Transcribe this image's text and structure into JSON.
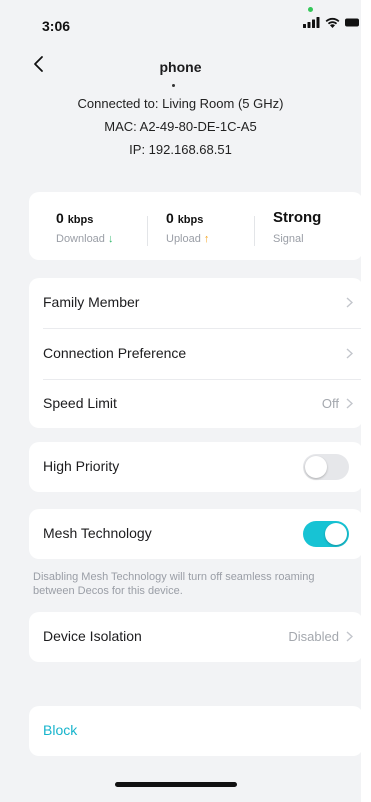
{
  "status_bar": {
    "time": "3:06"
  },
  "header": {
    "title": "phone"
  },
  "device_info": {
    "connected_to": "Connected to: Living Room (5 GHz)",
    "mac": "MAC: A2-49-80-DE-1C-A5",
    "ip": "IP: 192.168.68.51"
  },
  "stats": {
    "download": {
      "value": "0",
      "unit": "kbps",
      "label": "Download",
      "arrow": "↓",
      "arrow_color": "#33b86c"
    },
    "upload": {
      "value": "0",
      "unit": "kbps",
      "label": "Upload",
      "arrow": "↑",
      "arrow_color": "#f5a623"
    },
    "signal": {
      "value": "Strong",
      "label": "Signal"
    }
  },
  "settings": {
    "family_member": "Family Member",
    "connection_preference": "Connection Preference",
    "speed_limit": {
      "label": "Speed Limit",
      "value": "Off"
    }
  },
  "high_priority": {
    "label": "High Priority",
    "enabled": false
  },
  "mesh": {
    "label": "Mesh Technology",
    "enabled": true,
    "note": "Disabling Mesh Technology will turn off seamless roaming between Decos for this device."
  },
  "device_isolation": {
    "label": "Device Isolation",
    "value": "Disabled"
  },
  "block": {
    "label": "Block"
  },
  "colors": {
    "accent": "#17c3d4",
    "toggle_off": "#e6e7ea",
    "background": "#f2f3f5",
    "link": "#17b4cc"
  }
}
